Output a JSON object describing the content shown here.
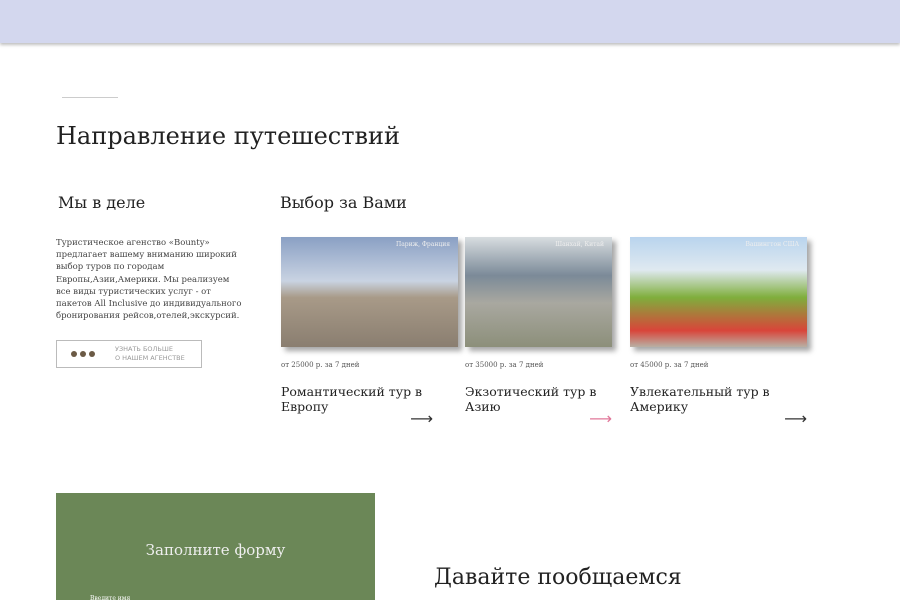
{
  "page": {
    "title": "Направление путешествий"
  },
  "about": {
    "heading": "Мы в деле",
    "text": "Туристическое агенство «Bounty» предлагает вашему вниманию широкий выбор туров по городам Европы,Азии,Америки. Мы реализуем все виды туристических услуг - от пакетов All Inclusive до индивидуального бронирования рейсов,отелей,экскурсий.",
    "more_line1": "УЗНАТЬ БОЛЬШЕ",
    "more_line2": "О НАШЕМ АГЕНСТВЕ"
  },
  "tours": {
    "heading": "Выбор за Вами",
    "items": [
      {
        "caption": "Париж, Франция",
        "price": "от 25000 р. за 7 дней",
        "title": "Романтический тур в Европу",
        "arrow_color": "#333333"
      },
      {
        "caption": "Шанхай, Китай",
        "price": "от 35000 р. за 7 дней",
        "title": "Экзотический тур в Азию",
        "arrow_color": "#e0789a"
      },
      {
        "caption": "Вашингтон США",
        "price": "от 45000 р. за 7 дней",
        "title": "Увлекательный тур в Америку",
        "arrow_color": "#333333"
      }
    ]
  },
  "form": {
    "title": "Заполните форму",
    "name_label": "Введите имя"
  },
  "contact": {
    "title": "Давайте пообщаемся"
  }
}
